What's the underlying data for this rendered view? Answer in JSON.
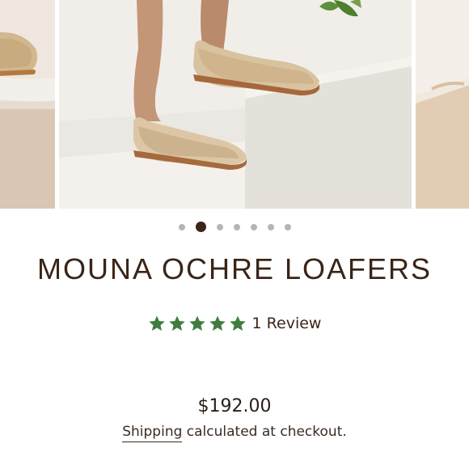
{
  "gallery": {
    "zoom_icon": "search-magnifier-icon",
    "active_index": 1,
    "dots": [
      1,
      2,
      3,
      4,
      5,
      6,
      7
    ]
  },
  "product": {
    "title": "MOUNA OCHRE LOAFERS",
    "rating": {
      "stars": 5,
      "review_text": "1 Review",
      "star_color": "#3f7d3f"
    },
    "price": "$192.00",
    "shipping": {
      "link_text": "Shipping",
      "rest_text": " calculated at checkout."
    }
  },
  "colors": {
    "text": "#3b2418",
    "dot": "#bdb3ae",
    "dot_active": "#3b2418"
  }
}
